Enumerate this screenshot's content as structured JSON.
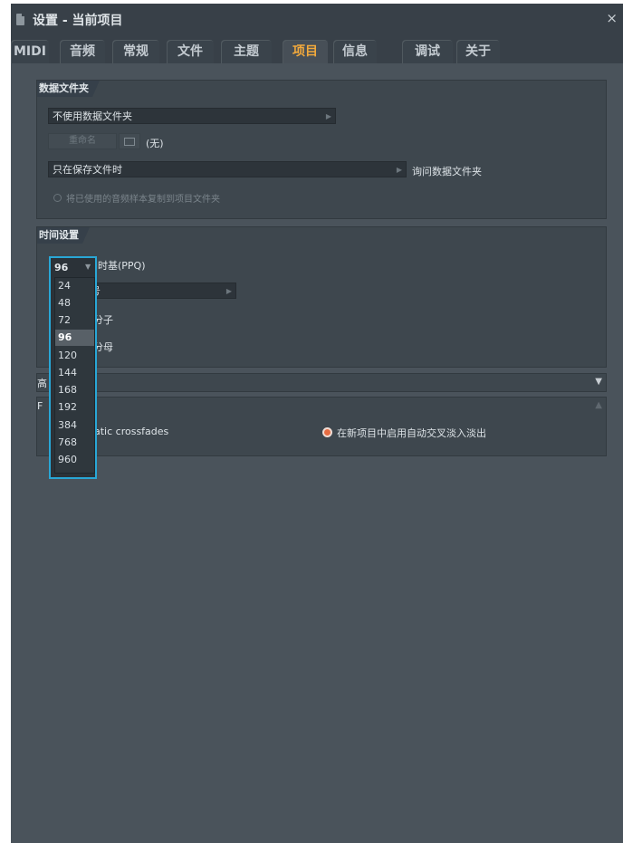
{
  "window": {
    "title": "设置 - 当前项目",
    "close": "×"
  },
  "tabs": [
    {
      "label": "MIDI"
    },
    {
      "label": "音频"
    },
    {
      "label": "常规"
    },
    {
      "label": "文件"
    },
    {
      "label": "主题"
    },
    {
      "label": "项目"
    },
    {
      "label": "信息"
    },
    {
      "label": "调试"
    },
    {
      "label": "关于"
    }
  ],
  "active_tab": "项目",
  "data_folder": {
    "title": "数据文件夹",
    "folder_select": "不使用数据文件夹",
    "rename_button": "重命名",
    "folder_value": "(无)",
    "save_select": "只在保存文件时",
    "ask_label": "询问数据文件夹",
    "copy_samples_label": "将已使用的音频样本复制到项目文件夹"
  },
  "time_settings": {
    "title": "时间设置",
    "ppq_value": "96",
    "ppq_label": "时基(PPQ)",
    "second_select_fragment": "号",
    "numerator_label": "分子",
    "denominator_label": "分母",
    "ppq_options": [
      "24",
      "48",
      "72",
      "96",
      "120",
      "144",
      "168",
      "192",
      "384",
      "768",
      "960"
    ],
    "ppq_selected": "96"
  },
  "collapsed_section": {
    "fragment": "高"
  },
  "crossfade_section": {
    "title_fragment": "F",
    "crossfades_label_fragment": "atic crossfades",
    "auto_crossfade_label": "在新项目中启用自动交叉淡入淡出"
  },
  "colors": {
    "accent": "#f2a93c",
    "highlight_border": "#29a7d6",
    "radio_on": "#e66c42"
  }
}
